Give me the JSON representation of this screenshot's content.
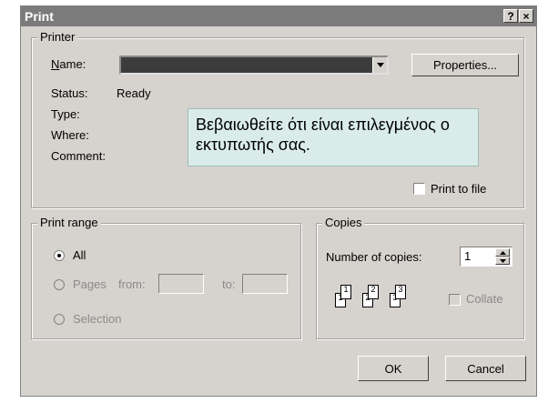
{
  "dialog": {
    "title": "Print",
    "help_button": "?",
    "close_button": "×"
  },
  "printer": {
    "legend": "Printer",
    "name_label": "Name:",
    "name_value": "",
    "properties_label": "Properties...",
    "status_label": "Status:",
    "status_value": "Ready",
    "type_label": "Type:",
    "where_label": "Where:",
    "comment_label": "Comment:",
    "print_to_file_label": "Print to file",
    "print_to_file_checked": false
  },
  "callout": {
    "text": "Βεβαιωθείτε ότι είναι επιλεγμένος ο εκτυπωτής σας."
  },
  "print_range": {
    "legend": "Print range",
    "all_label": "All",
    "pages_label": "Pages",
    "from_label": "from:",
    "to_label": "to:",
    "selection_label": "Selection",
    "selected": "All"
  },
  "copies": {
    "legend": "Copies",
    "number_label": "Number of copies:",
    "number_value": "1",
    "collate_label": "Collate",
    "page_numbers": [
      "1",
      "1",
      "2",
      "2",
      "3",
      "3"
    ]
  },
  "buttons": {
    "ok_label": "OK",
    "cancel_label": "Cancel"
  },
  "colors": {
    "dialog_bg": "#d6d3ce",
    "titlebar_bg": "#7b7b7b",
    "callout_bg": "#d9ece9",
    "combo_bg": "#3c3c3c"
  }
}
